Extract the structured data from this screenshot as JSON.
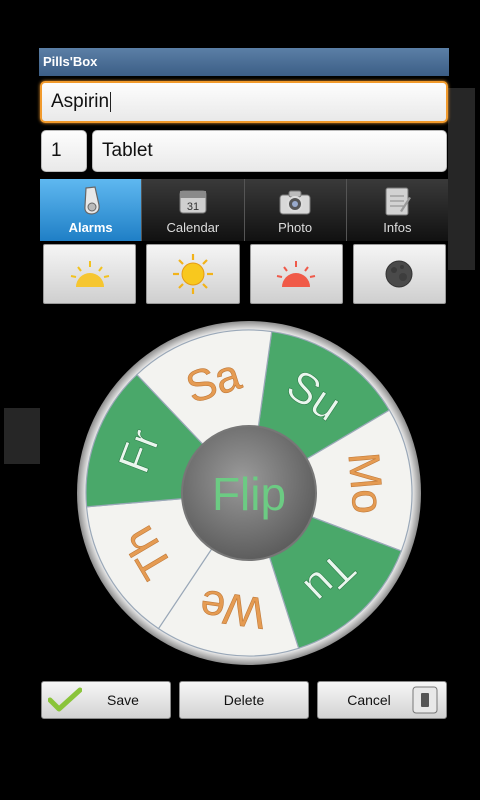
{
  "app": {
    "title": "Pills'Box"
  },
  "medicine": {
    "name": "Aspirin",
    "quantity": "1",
    "unit": "Tablet"
  },
  "tabs": [
    {
      "label": "Alarms",
      "icon": "whistle-icon",
      "active": true
    },
    {
      "label": "Calendar",
      "icon": "calendar-icon",
      "day": "31"
    },
    {
      "label": "Photo",
      "icon": "camera-icon"
    },
    {
      "label": "Infos",
      "icon": "notepad-icon"
    }
  ],
  "times_of_day": [
    {
      "name": "morning",
      "icon": "sunrise-icon"
    },
    {
      "name": "noon",
      "icon": "sun-icon"
    },
    {
      "name": "evening",
      "icon": "sunset-icon"
    },
    {
      "name": "night",
      "icon": "moon-icon"
    }
  ],
  "day_wheel": {
    "center_label": "Flip",
    "days": [
      {
        "label": "Su",
        "selected": true
      },
      {
        "label": "Mo",
        "selected": false
      },
      {
        "label": "Tu",
        "selected": true
      },
      {
        "label": "We",
        "selected": false
      },
      {
        "label": "Th",
        "selected": false
      },
      {
        "label": "Fr",
        "selected": true
      },
      {
        "label": "Sa",
        "selected": false
      }
    ],
    "colors": {
      "selected": "#4aa86a",
      "unselected": "#f3f3f0",
      "selected_text": "#eaf6ee",
      "unselected_text": "#e59b52"
    }
  },
  "actions": {
    "save": "Save",
    "delete": "Delete",
    "cancel": "Cancel"
  }
}
